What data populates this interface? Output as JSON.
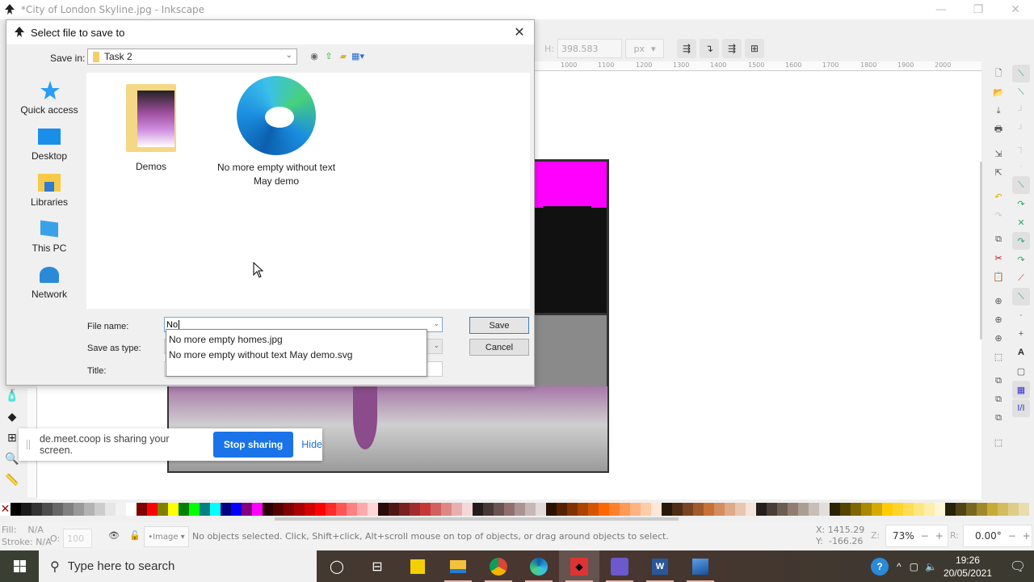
{
  "window": {
    "title": "*City of London Skyline.jpg - Inkscape",
    "controls": {
      "minimize": "—",
      "restore": "❐",
      "close": "✕"
    }
  },
  "toolbar": {
    "h_label": "H:",
    "h_value": "398.583",
    "unit": "px"
  },
  "ruler": {
    "ticks": [
      "1000",
      "1100",
      "1200",
      "1300",
      "1400",
      "1500",
      "1600",
      "1700",
      "1800",
      "1900",
      "2000"
    ]
  },
  "dialog": {
    "title": "Select file to save to",
    "save_in_label": "Save in:",
    "save_in_value": "Task 2",
    "places": [
      {
        "label": "Quick access",
        "icon": "star-icon"
      },
      {
        "label": "Desktop",
        "icon": "desktop-icon"
      },
      {
        "label": "Libraries",
        "icon": "libraries-icon"
      },
      {
        "label": "This PC",
        "icon": "computer-icon"
      },
      {
        "label": "Network",
        "icon": "network-icon"
      }
    ],
    "files": [
      {
        "label": "Demos",
        "type": "folder"
      },
      {
        "label": "No more empty without text May demo",
        "type": "edge-file"
      }
    ],
    "file_name_label": "File name:",
    "file_name_value": "No",
    "save_as_type_label": "Save as type:",
    "title_label": "Title:",
    "autocomplete": [
      "No more empty homes.jpg",
      "No more empty without text May demo.svg"
    ],
    "save_button": "Save",
    "cancel_button": "Cancel"
  },
  "sharebar": {
    "message": "de.meet.coop is sharing your screen.",
    "stop_button": "Stop sharing",
    "hide_link": "Hide"
  },
  "palette": {
    "colors": [
      "#000000",
      "#1a1a1a",
      "#333333",
      "#4d4d4d",
      "#666666",
      "#808080",
      "#999999",
      "#b3b3b3",
      "#cccccc",
      "#e6e6e6",
      "#f2f2f2",
      "#ffffff",
      "#800000",
      "#ff0000",
      "#808000",
      "#ffff00",
      "#008000",
      "#00ff00",
      "#008080",
      "#00ffff",
      "#000080",
      "#0000ff",
      "#800080",
      "#ff00ff",
      "#2b0000",
      "#550000",
      "#800000",
      "#aa0000",
      "#d40000",
      "#ff0000",
      "#ff2a2a",
      "#ff5555",
      "#ff8080",
      "#ffaaaa",
      "#ffd5d5",
      "#280b0b",
      "#501616",
      "#782121",
      "#a02c2c",
      "#c83737",
      "#d35f5f",
      "#de8787",
      "#e9afaf",
      "#f4d7d7",
      "#241c1c",
      "#483737",
      "#6c5353",
      "#916f6f",
      "#ac9393",
      "#c8b7b7",
      "#e3dbdb",
      "#2b1100",
      "#552200",
      "#803300",
      "#aa4400",
      "#d45500",
      "#ff6600",
      "#ff7f2a",
      "#ff9955",
      "#ffb380",
      "#ffccaa",
      "#ffe6d5",
      "#28170b",
      "#502d16",
      "#784421",
      "#a05a2c",
      "#c87137",
      "#d38d5f",
      "#deaa87",
      "#e9c6af",
      "#f4e3d7",
      "#241f1c",
      "#483e37",
      "#6c5d53",
      "#917c6f",
      "#ac9d93",
      "#c8beb7",
      "#e3dedb",
      "#2b2200",
      "#554400",
      "#806600",
      "#aa8800",
      "#d4aa00",
      "#ffcc00",
      "#ffd42a",
      "#ffdd55",
      "#ffe680",
      "#ffeeaa",
      "#fff6d5",
      "#28220b",
      "#504416",
      "#786721",
      "#a0892c",
      "#c8ab37",
      "#d3bc5f",
      "#decd87",
      "#e9ddaf"
    ]
  },
  "statusbar": {
    "fill_label": "Fill:",
    "fill_value": "N/A",
    "stroke_label": "Stroke:",
    "stroke_value": "N/A",
    "opacity_label": "O:",
    "opacity_value": "100",
    "layer": "•Image",
    "message": "No objects selected. Click, Shift+click, Alt+scroll mouse on top of objects, or drag around objects to select.",
    "x_label": "X:",
    "x_value": "1415.29",
    "y_label": "Y:",
    "y_value": "-166.26",
    "zoom_label": "Z:",
    "zoom_value": "73%",
    "rotate_label": "R:",
    "rotate_value": "0.00°"
  },
  "taskbar": {
    "search_placeholder": "Type here to search",
    "apps": [
      "cortana",
      "task-view",
      "sticky-notes",
      "file-explorer",
      "chrome",
      "edge",
      "inkscape",
      "gimp",
      "word",
      "photos"
    ],
    "time": "19:26",
    "date": "20/05/2021"
  }
}
